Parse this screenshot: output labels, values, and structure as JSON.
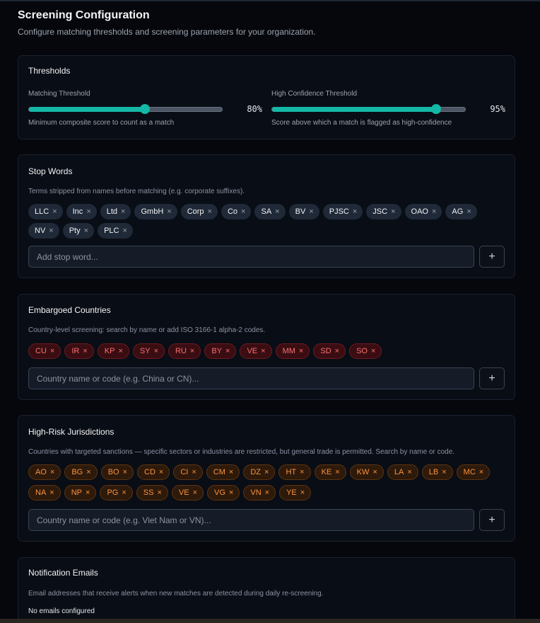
{
  "header": {
    "title": "Screening Configuration",
    "subtitle": "Configure matching thresholds and screening parameters for your organization."
  },
  "thresholds": {
    "title": "Thresholds",
    "matching": {
      "label": "Matching Threshold",
      "value": 80,
      "display": "80%",
      "help": "Minimum composite score to count as a match"
    },
    "high_confidence": {
      "label": "High Confidence Threshold",
      "value": 95,
      "display": "95%",
      "help": "Score above which a match is flagged as high-confidence"
    }
  },
  "stop_words": {
    "title": "Stop Words",
    "description": "Terms stripped from names before matching (e.g. corporate suffixes).",
    "items": [
      "LLC",
      "Inc",
      "Ltd",
      "GmbH",
      "Corp",
      "Co",
      "SA",
      "BV",
      "PJSC",
      "JSC",
      "OAO",
      "AG",
      "NV",
      "Pty",
      "PLC"
    ],
    "placeholder": "Add stop word...",
    "add_label": "+"
  },
  "embargoed": {
    "title": "Embargoed Countries",
    "description": "Country-level screening: search by name or add ISO 3166-1 alpha-2 codes.",
    "items": [
      "CU",
      "IR",
      "KP",
      "SY",
      "RU",
      "BY",
      "VE",
      "MM",
      "SD",
      "SO"
    ],
    "placeholder": "Country name or code (e.g. China or CN)...",
    "add_label": "+"
  },
  "high_risk": {
    "title": "High-Risk Jurisdictions",
    "description": "Countries with targeted sanctions — specific sectors or industries are restricted, but general trade is permitted. Search by name or code.",
    "items": [
      "AO",
      "BG",
      "BO",
      "CD",
      "CI",
      "CM",
      "DZ",
      "HT",
      "KE",
      "KW",
      "LA",
      "LB",
      "MC",
      "NA",
      "NP",
      "PG",
      "SS",
      "VE",
      "VG",
      "VN",
      "YE"
    ],
    "placeholder": "Country name or code (e.g. Viet Nam or VN)...",
    "add_label": "+"
  },
  "notifications": {
    "title": "Notification Emails",
    "description": "Email addresses that receive alerts when new matches are detected during daily re-screening.",
    "empty": "No emails configured"
  },
  "icons": {
    "remove": "close-icon",
    "add": "plus-icon"
  },
  "colors": {
    "accent": "#14b8a6",
    "embargo": "#f87171",
    "high_risk": "#fb923c"
  }
}
